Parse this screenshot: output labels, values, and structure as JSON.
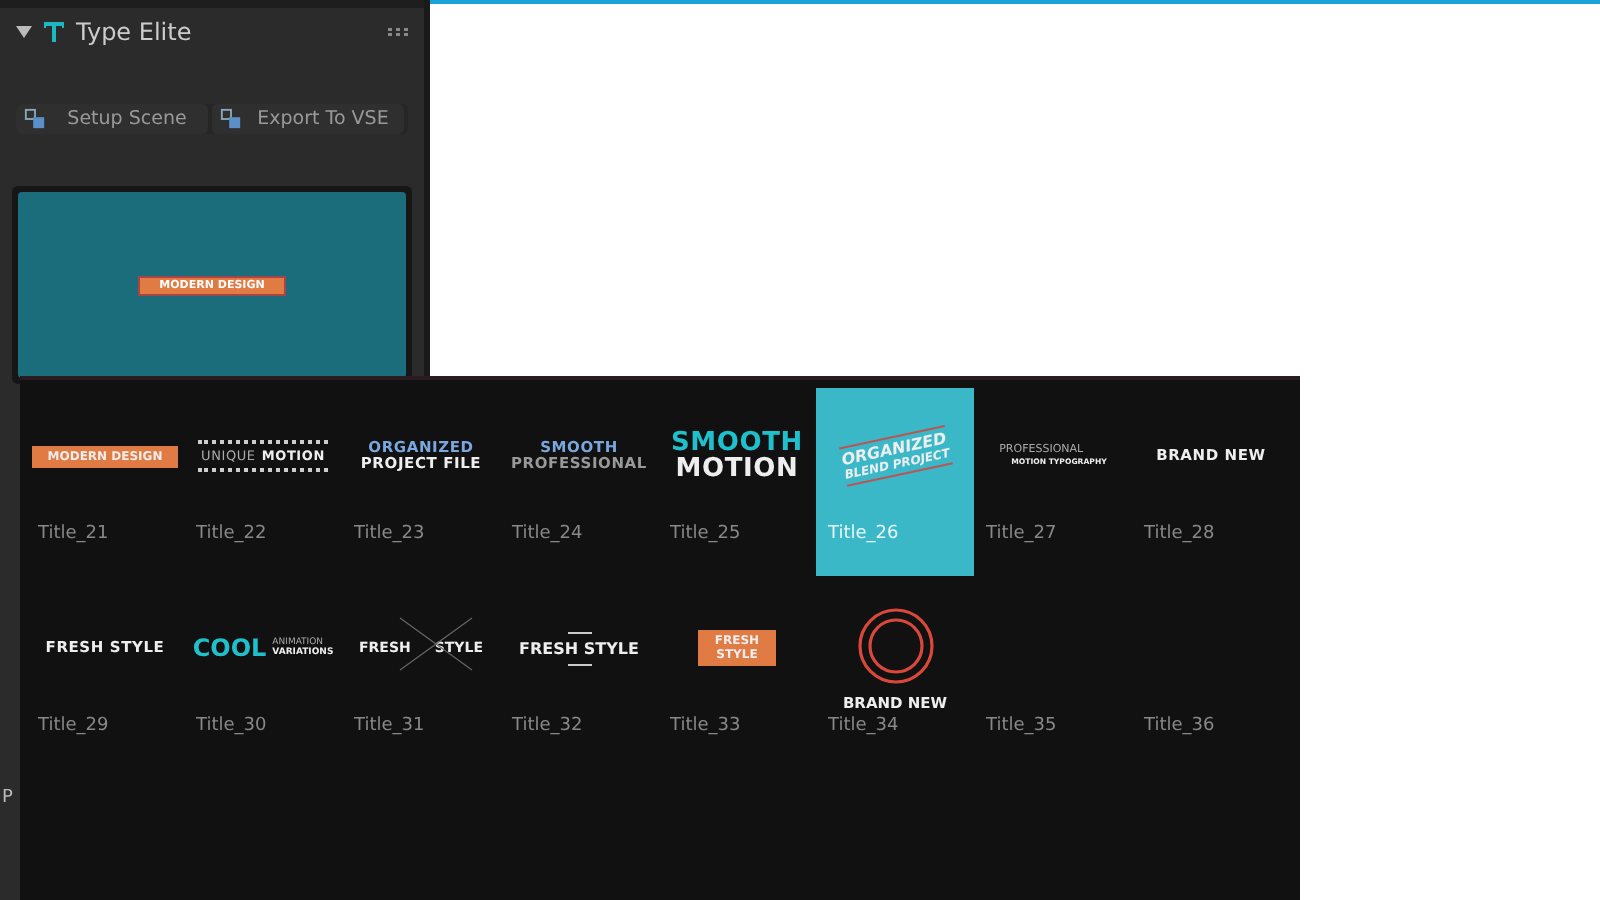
{
  "panel": {
    "title": "Type Elite",
    "expanded": true,
    "buttons": [
      "Setup Scene",
      "Export To VSE"
    ],
    "preview": {
      "text": "MODERN DESIGN"
    },
    "cut_label": "P"
  },
  "popup": {
    "items": [
      {
        "label": "Title_21",
        "selected": false,
        "preview": {
          "kind": "banner",
          "lines": [
            {
              "text": "MODERN DESIGN",
              "kind": "plain"
            }
          ]
        }
      },
      {
        "label": "Title_22",
        "selected": false,
        "preview": {
          "kind": "dotted",
          "lines": [
            {
              "text": "UNIQUE",
              "kind": "light"
            },
            {
              "text": "MOTION",
              "kind": "plain"
            }
          ]
        }
      },
      {
        "label": "Title_23",
        "selected": false,
        "preview": {
          "kind": "stack",
          "lines": [
            {
              "text": "ORGANIZED",
              "kind": "accent"
            },
            {
              "text": "PROJECT FILE",
              "kind": "plain"
            }
          ]
        }
      },
      {
        "label": "Title_24",
        "selected": false,
        "preview": {
          "kind": "stack",
          "lines": [
            {
              "text": "SMOOTH",
              "kind": "accent"
            },
            {
              "text": "PROFESSIONAL",
              "kind": "muted"
            }
          ]
        }
      },
      {
        "label": "Title_25",
        "selected": false,
        "preview": {
          "kind": "big",
          "lines": [
            {
              "text": "SMOOTH",
              "kind": "teal"
            },
            {
              "text": "MOTION",
              "kind": "plain"
            }
          ]
        }
      },
      {
        "label": "Title_26",
        "selected": true,
        "preview": {
          "kind": "slant",
          "lines": [
            {
              "text": "ORGANIZED",
              "kind": "plain"
            },
            {
              "text": "BLEND PROJECT",
              "kind": "plain"
            }
          ]
        }
      },
      {
        "label": "Title_27",
        "selected": false,
        "preview": {
          "kind": "offset",
          "lines": [
            {
              "text": "PROFESSIONAL",
              "kind": "light"
            },
            {
              "text": "MOTION TYPOGRAPHY",
              "kind": "plain"
            }
          ]
        }
      },
      {
        "label": "Title_28",
        "selected": false,
        "preview": {
          "kind": "stack",
          "lines": [
            {
              "text": "BRAND NEW",
              "kind": "plain"
            }
          ]
        }
      },
      {
        "label": "Title_29",
        "selected": false,
        "preview": {
          "kind": "stack",
          "lines": [
            {
              "text": "FRESH STYLE",
              "kind": "plain"
            }
          ]
        }
      },
      {
        "label": "Title_30",
        "selected": false,
        "preview": {
          "kind": "tag",
          "lines": [
            {
              "text": "COOL",
              "kind": "teal"
            },
            {
              "text": "ANIMATION",
              "kind": "light"
            },
            {
              "text": "VARIATIONS",
              "kind": "plain"
            }
          ]
        }
      },
      {
        "label": "Title_31",
        "selected": false,
        "preview": {
          "kind": "cross",
          "lines": [
            {
              "text": "FRESH",
              "kind": "plain"
            },
            {
              "text": "STYLE",
              "kind": "plain"
            }
          ]
        }
      },
      {
        "label": "Title_32",
        "selected": false,
        "preview": {
          "kind": "bars",
          "lines": [
            {
              "text": "FRESH STYLE",
              "kind": "plain"
            }
          ]
        }
      },
      {
        "label": "Title_33",
        "selected": false,
        "preview": {
          "kind": "banner",
          "lines": [
            {
              "text": "FRESH",
              "kind": "plain"
            },
            {
              "text": "STYLE",
              "kind": "plain"
            }
          ]
        }
      },
      {
        "label": "Title_34",
        "selected": false,
        "preview": {
          "kind": "ring",
          "lines": [
            {
              "text": "BRAND NEW",
              "kind": "plain"
            }
          ]
        }
      },
      {
        "label": "Title_35",
        "selected": false,
        "preview": {
          "kind": "blank"
        }
      },
      {
        "label": "Title_36",
        "selected": false,
        "preview": {
          "kind": "blank"
        }
      }
    ]
  }
}
